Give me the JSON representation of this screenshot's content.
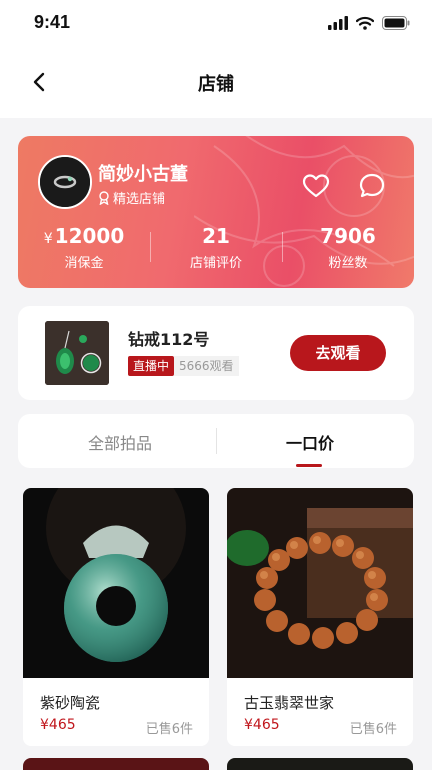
{
  "status_bar": {
    "time": "9:41"
  },
  "nav": {
    "title": "店铺"
  },
  "shop": {
    "name": "简妙小古董",
    "tag": "精选店铺",
    "stats": [
      {
        "prefix": "¥",
        "value": "12000",
        "label": "消保金"
      },
      {
        "prefix": "",
        "value": "21",
        "label": "店铺评价"
      },
      {
        "prefix": "",
        "value": "7906",
        "label": "粉丝数"
      }
    ]
  },
  "live": {
    "name": "钻戒112号",
    "badge": "直播中",
    "views": "5666观看",
    "button": "去观看"
  },
  "tabs": [
    "全部拍品",
    "一口价"
  ],
  "products": [
    {
      "title": "紫砂陶瓷",
      "price": "¥465",
      "sold": "已售6件"
    },
    {
      "title": "古玉翡翠世家",
      "price": "¥465",
      "sold": "已售6件"
    }
  ],
  "colors": {
    "accent": "#b8171c",
    "card_gradient_start": "#ee7a63",
    "card_gradient_end": "#ea4f67"
  }
}
